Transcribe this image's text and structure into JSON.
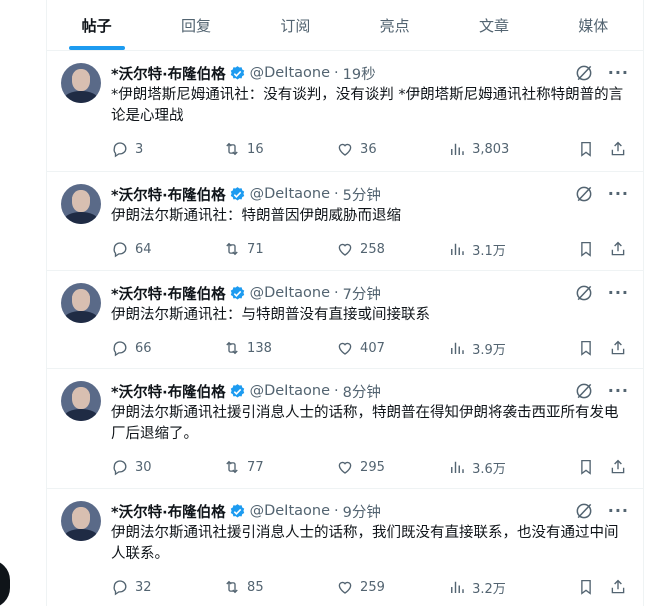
{
  "tabs": [
    {
      "label": "帖子",
      "active": true
    },
    {
      "label": "回复",
      "active": false
    },
    {
      "label": "订阅",
      "active": false
    },
    {
      "label": "亮点",
      "active": false
    },
    {
      "label": "文章",
      "active": false
    },
    {
      "label": "媒体",
      "active": false
    }
  ],
  "accent_color": "#1d9bf0",
  "tweets": [
    {
      "name": "*沃尔特·布隆伯格",
      "handle": "@DeItaone",
      "sep": "·",
      "time": "19秒",
      "text": "*伊朗塔斯尼姆通讯社：没有谈判，没有谈判 *伊朗塔斯尼姆通讯社称特朗普的言论是心理战",
      "replies": "3",
      "retweets": "16",
      "likes": "36",
      "views": "3,803"
    },
    {
      "name": "*沃尔特·布隆伯格",
      "handle": "@DeItaone",
      "sep": "·",
      "time": "5分钟",
      "text": "伊朗法尔斯通讯社：特朗普因伊朗威胁而退缩",
      "replies": "64",
      "retweets": "71",
      "likes": "258",
      "views": "3.1万"
    },
    {
      "name": "*沃尔特·布隆伯格",
      "handle": "@DeItaone",
      "sep": "·",
      "time": "7分钟",
      "text": "伊朗法尔斯通讯社：与特朗普没有直接或间接联系",
      "replies": "66",
      "retweets": "138",
      "likes": "407",
      "views": "3.9万"
    },
    {
      "name": "*沃尔特·布隆伯格",
      "handle": "@DeItaone",
      "sep": "·",
      "time": "8分钟",
      "text": "伊朗法尔斯通讯社援引消息人士的话称，特朗普在得知伊朗将袭击西亚所有发电厂后退缩了。",
      "replies": "30",
      "retweets": "77",
      "likes": "295",
      "views": "3.6万"
    },
    {
      "name": "*沃尔特·布隆伯格",
      "handle": "@DeItaone",
      "sep": "·",
      "time": "9分钟",
      "text": "伊朗法尔斯通讯社援引消息人士的话称，我们既没有直接联系，也没有通过中间人联系。",
      "replies": "32",
      "retweets": "85",
      "likes": "259",
      "views": "3.2万"
    }
  ]
}
